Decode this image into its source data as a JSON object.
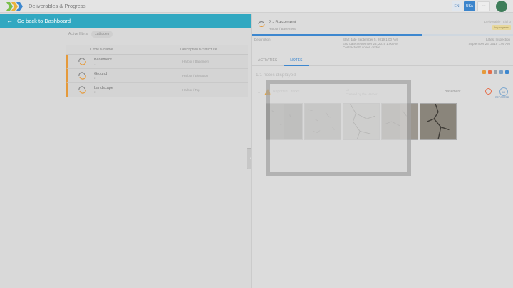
{
  "app": {
    "title": "Deliverables & Progress",
    "buttons": [
      "EN",
      "USA",
      "•••"
    ]
  },
  "left": {
    "back_label": "Go back to Dashboard",
    "filter_label": "Active filters",
    "filter_chip": "Latitudes",
    "columns": [
      "Code & Name",
      "Description & Structure"
    ],
    "rows": [
      {
        "title": "Basement",
        "sub": "1",
        "desc": "Harbor / Basement"
      },
      {
        "title": "Ground",
        "sub": "2",
        "desc": "Harbor / Elevation"
      },
      {
        "title": "Landscape",
        "sub": "3",
        "desc": "Harbor / Top"
      }
    ]
  },
  "right": {
    "title": "2 - Basement",
    "subtitle": "Harbor / Basement",
    "top_right": "Deliverable | Lit | 0",
    "badge": "In progress",
    "progress": 0.65,
    "meta_left": [
      "Description"
    ],
    "meta_mid": [
      "Start date  September 5, 2019 1:00 AM",
      "End date   September 23, 2019 1:00 AM",
      "Contractor  Europe/London"
    ],
    "meta_right": [
      "Latest Inspection",
      "September 23, 2019 1:00 AM"
    ],
    "tabs": [
      "ACTIVITIES",
      "NOTES"
    ],
    "active_tab": "NOTES",
    "notes_count": "1/1 notes displayed",
    "note": {
      "label": "Reported Cracks",
      "created": [
        "Lit",
        "Created by the Harbor"
      ],
      "location": "Basement",
      "user_initials": "IO",
      "user_label": "REPORTED"
    },
    "legend_colors": [
      "#e59a3b",
      "#e56d4a",
      "#9aa1a8",
      "#7aa0c6",
      "#3d87cf"
    ]
  },
  "colors": {
    "accent": "#31a8c1",
    "primary": "#3d87cf",
    "row_marker": "#e59a3b",
    "warning": "#e8a33a"
  }
}
